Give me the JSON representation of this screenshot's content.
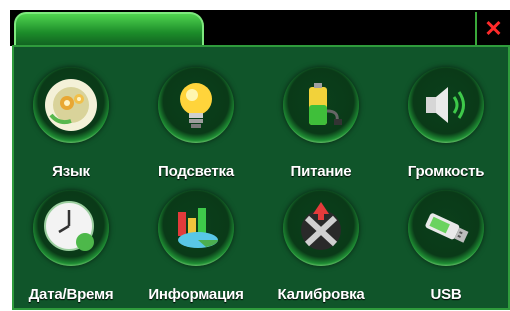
{
  "window": {
    "close_glyph": "✕",
    "close_color": "#ff2a2a"
  },
  "settings": {
    "items": [
      {
        "label": "Язык",
        "icon": "language-disc-icon"
      },
      {
        "label": "Подсветка",
        "icon": "lightbulb-icon"
      },
      {
        "label": "Питание",
        "icon": "battery-icon"
      },
      {
        "label": "Громкость",
        "icon": "speaker-icon"
      },
      {
        "label": "Дата/Время",
        "icon": "clock-icon"
      },
      {
        "label": "Информация",
        "icon": "info-chart-icon"
      },
      {
        "label": "Калибровка",
        "icon": "calibration-icon"
      },
      {
        "label": "USB",
        "icon": "usb-drive-icon"
      }
    ]
  },
  "colors": {
    "panel": "#10552a",
    "accent": "#2f9b3c",
    "tab": "#1c8c2a"
  }
}
